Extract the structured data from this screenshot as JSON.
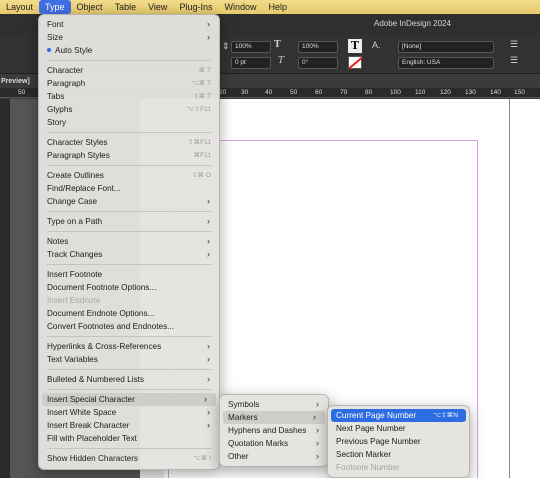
{
  "menubar": {
    "items": [
      "Layout",
      "Type",
      "Object",
      "Table",
      "View",
      "Plug-Ins",
      "Window",
      "Help"
    ],
    "active_index": 1
  },
  "app": {
    "title": "Adobe InDesign 2024"
  },
  "control_bar": {
    "h_scale": "100%",
    "v_scale": "100%",
    "tracking": "0 pt",
    "skew": "0°",
    "char_style": "[None]",
    "language": "English: USA"
  },
  "view_tab": "Preview]",
  "ruler": {
    "ticks": [
      "50",
      "0",
      "10",
      "20",
      "30",
      "40",
      "50",
      "60",
      "70",
      "80",
      "90",
      "100",
      "110",
      "120",
      "130",
      "140",
      "150"
    ]
  },
  "type_menu": {
    "font": "Font",
    "size": "Size",
    "auto_style": "Auto Style",
    "character": "Character",
    "character_sc": "⌘ T",
    "paragraph": "Paragraph",
    "paragraph_sc": "⌥⌘ T",
    "tabs": "Tabs",
    "tabs_sc": "⇧⌘ T",
    "glyphs": "Glyphs",
    "glyphs_sc": "⌥⇧F11",
    "story": "Story",
    "character_styles": "Character Styles",
    "character_styles_sc": "⇧⌘F11",
    "paragraph_styles": "Paragraph Styles",
    "paragraph_styles_sc": "⌘F11",
    "create_outlines": "Create Outlines",
    "create_outlines_sc": "⇧⌘ O",
    "find_replace_font": "Find/Replace Font...",
    "change_case": "Change Case",
    "type_on_path": "Type on a Path",
    "notes": "Notes",
    "track_changes": "Track Changes",
    "insert_footnote": "Insert Footnote",
    "doc_footnote_options": "Document Footnote Options...",
    "insert_endnote": "Insert Endnote",
    "doc_endnote_options": "Document Endnote Options...",
    "convert_footnotes": "Convert Footnotes and Endnotes...",
    "hyperlinks": "Hyperlinks & Cross-References",
    "text_variables": "Text Variables",
    "bulleted_lists": "Bulleted & Numbered Lists",
    "insert_special_character": "Insert Special Character",
    "insert_white_space": "Insert White Space",
    "insert_break_character": "Insert Break Character",
    "fill_placeholder": "Fill with Placeholder Text",
    "show_hidden": "Show Hidden Characters",
    "show_hidden_sc": "⌥⌘ I"
  },
  "isc_menu": {
    "symbols": "Symbols",
    "markers": "Markers",
    "hyphens_dashes": "Hyphens and Dashes",
    "quotation_marks": "Quotation Marks",
    "other": "Other"
  },
  "markers_menu": {
    "current_page_number": "Current Page Number",
    "current_page_number_sc": "⌥⇧⌘N",
    "next_page_number": "Next Page Number",
    "previous_page_number": "Previous Page Number",
    "section_marker": "Section Marker",
    "footnote_number": "Footnote Number"
  },
  "colors": {
    "menubar": "#ecd27a",
    "highlight": "#2d6de1",
    "margin_guide": "#d59de0"
  }
}
